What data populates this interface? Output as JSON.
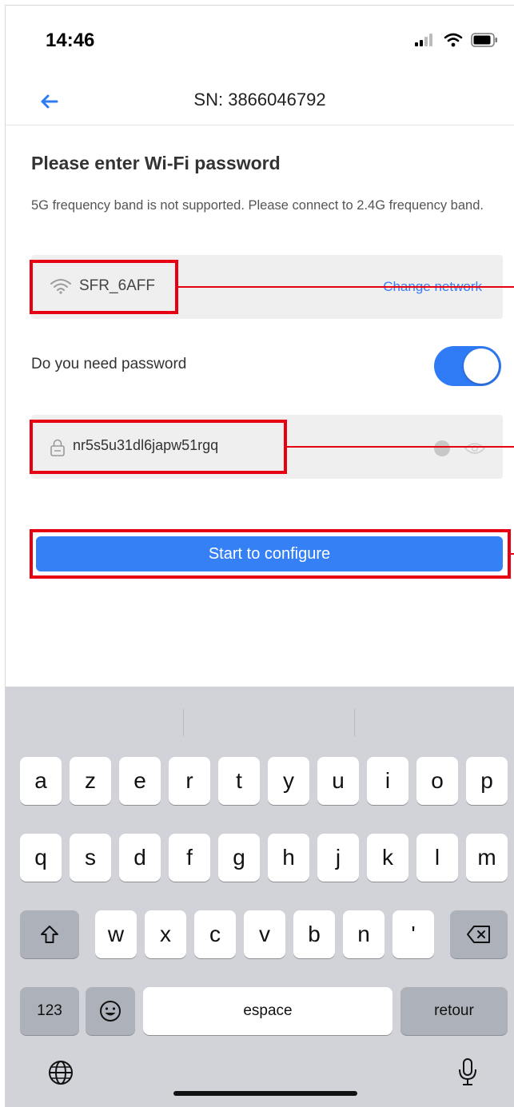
{
  "status_bar": {
    "time": "14:46"
  },
  "nav": {
    "title": "SN: 3866046792"
  },
  "form": {
    "heading": "Please enter Wi-Fi password",
    "hint": "5G frequency band is not supported. Please connect to 2.4G frequency band.",
    "wifi_name": "SFR_6AFF",
    "change_network": "Change network",
    "password_toggle_label": "Do you need password",
    "password_toggle_on": true,
    "password_value": "nr5s5u31dl6japw51rgq",
    "submit": "Start to configure"
  },
  "colors": {
    "accent": "#3480f4",
    "highlight": "#e60012"
  },
  "keyboard": {
    "row1": [
      "a",
      "z",
      "e",
      "r",
      "t",
      "y",
      "u",
      "i",
      "o",
      "p"
    ],
    "row2": [
      "q",
      "s",
      "d",
      "f",
      "g",
      "h",
      "j",
      "k",
      "l",
      "m"
    ],
    "row3": [
      "w",
      "x",
      "c",
      "v",
      "b",
      "n",
      "'"
    ],
    "numbers": "123",
    "space": "espace",
    "return": "retour"
  }
}
